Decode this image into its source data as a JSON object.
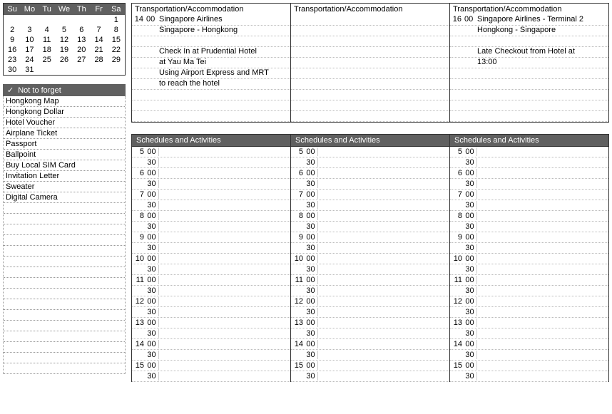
{
  "calendar": {
    "days": [
      "Su",
      "Mo",
      "Tu",
      "We",
      "Th",
      "Fr",
      "Sa"
    ],
    "cells": [
      "",
      "",
      "",
      "",
      "",
      "",
      "1",
      "2",
      "3",
      "4",
      "5",
      "6",
      "7",
      "8",
      "9",
      "10",
      "11",
      "12",
      "13",
      "14",
      "15",
      "16",
      "17",
      "18",
      "19",
      "20",
      "21",
      "22",
      "23",
      "24",
      "25",
      "26",
      "27",
      "28",
      "29",
      "30",
      "31",
      "",
      "",
      "",
      "",
      ""
    ]
  },
  "ntf": {
    "title": "Not to forget",
    "items": [
      "Hongkong Map",
      "Hongkong Dollar",
      "Hotel Voucher",
      "Airplane Ticket",
      "Passport",
      "Ballpoint",
      "Buy Local SIM Card",
      "Invitation Letter",
      "Sweater",
      "Digital Camera",
      "",
      "",
      "",
      "",
      "",
      "",
      "",
      "",
      "",
      "",
      "",
      "",
      "",
      "",
      "",
      ""
    ]
  },
  "transport": {
    "title": "Transportation/Accommodation",
    "cols": [
      {
        "rows": [
          {
            "hr": "14",
            "min": "00",
            "text": "Singapore Airlines"
          },
          {
            "hr": "",
            "min": "",
            "text": "Singapore - Hongkong"
          },
          {
            "hr": "",
            "min": "",
            "text": ""
          },
          {
            "hr": "",
            "min": "",
            "text": "Check In at Prudential Hotel"
          },
          {
            "hr": "",
            "min": "",
            "text": "at Yau Ma Tei"
          },
          {
            "hr": "",
            "min": "",
            "text": "Using Airport Express and MRT"
          },
          {
            "hr": "",
            "min": "",
            "text": "to reach the hotel"
          },
          {
            "hr": "",
            "min": "",
            "text": ""
          },
          {
            "hr": "",
            "min": "",
            "text": ""
          },
          {
            "hr": "",
            "min": "",
            "text": ""
          }
        ]
      },
      {
        "rows": [
          {
            "hr": "",
            "min": "",
            "text": ""
          },
          {
            "hr": "",
            "min": "",
            "text": ""
          },
          {
            "hr": "",
            "min": "",
            "text": ""
          },
          {
            "hr": "",
            "min": "",
            "text": ""
          },
          {
            "hr": "",
            "min": "",
            "text": ""
          },
          {
            "hr": "",
            "min": "",
            "text": ""
          },
          {
            "hr": "",
            "min": "",
            "text": ""
          },
          {
            "hr": "",
            "min": "",
            "text": ""
          },
          {
            "hr": "",
            "min": "",
            "text": ""
          },
          {
            "hr": "",
            "min": "",
            "text": ""
          }
        ]
      },
      {
        "rows": [
          {
            "hr": "16",
            "min": "00",
            "text": "Singapore Airlines - Terminal 2"
          },
          {
            "hr": "",
            "min": "",
            "text": "Hongkong - Singapore"
          },
          {
            "hr": "",
            "min": "",
            "text": ""
          },
          {
            "hr": "",
            "min": "",
            "text": "Late Checkout from Hotel at"
          },
          {
            "hr": "",
            "min": "",
            "text": "13:00"
          },
          {
            "hr": "",
            "min": "",
            "text": ""
          },
          {
            "hr": "",
            "min": "",
            "text": ""
          },
          {
            "hr": "",
            "min": "",
            "text": ""
          },
          {
            "hr": "",
            "min": "",
            "text": ""
          },
          {
            "hr": "",
            "min": "",
            "text": ""
          }
        ]
      }
    ]
  },
  "schedules": {
    "title": "Schedules and Activities",
    "hours": [
      5,
      6,
      7,
      8,
      9,
      10,
      11,
      12,
      13,
      14,
      15
    ]
  }
}
